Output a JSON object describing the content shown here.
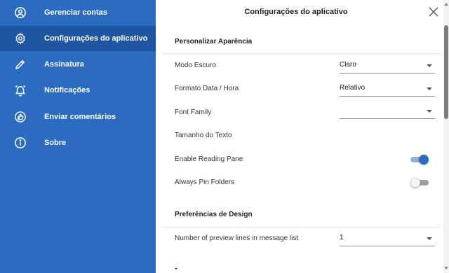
{
  "sidebar": {
    "items": [
      {
        "label": "Gerenciar contas",
        "icon": "account-circle-icon",
        "active": false
      },
      {
        "label": "Configurações do aplicativo",
        "icon": "gear-icon",
        "active": true
      },
      {
        "label": "Assinatura",
        "icon": "pencil-icon",
        "active": false
      },
      {
        "label": "Notificações",
        "icon": "alarm-bell-icon",
        "active": false
      },
      {
        "label": "Enviar comentários",
        "icon": "thumbs-up-feedback-icon",
        "active": false
      },
      {
        "label": "Sobre",
        "icon": "info-icon",
        "active": false
      }
    ]
  },
  "main": {
    "title": "Configurações do aplicativo",
    "close_icon": "close-icon",
    "sections": [
      {
        "header": "Personalizar Aparência",
        "rows": [
          {
            "label": "Modo Escuro",
            "control": "select",
            "value": "Claro"
          },
          {
            "label": "Formato Data / Hora",
            "control": "select",
            "value": "Relativo"
          },
          {
            "label": "Font Family",
            "control": "select",
            "value": ""
          },
          {
            "label": "Tamanho do Texto",
            "control": "none"
          },
          {
            "label": "Enable Reading Pane",
            "control": "toggle",
            "checked": true
          },
          {
            "label": "Always Pin Folders",
            "control": "toggle",
            "checked": false
          }
        ]
      },
      {
        "header": "Preferências de Design",
        "rows": [
          {
            "label": "Number of preview lines in message list",
            "control": "select",
            "value": "1"
          }
        ]
      }
    ],
    "cut_off_text": "-"
  },
  "colors": {
    "sidebar_bg": "#2b6cc0",
    "sidebar_active_bg": "#1f56a3",
    "toggle_on": "#2b6cc0"
  }
}
